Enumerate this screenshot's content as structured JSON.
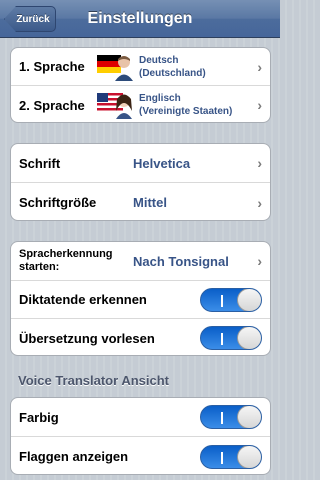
{
  "nav": {
    "back_label": "Zurück",
    "title": "Einstellungen"
  },
  "languages": [
    {
      "label": "1. Sprache",
      "name_line1": "Deutsch",
      "name_line2": "(Deutschland)",
      "flag": "germany-flag-icon"
    },
    {
      "label": "2. Sprache",
      "name_line1": "Englisch",
      "name_line2": "(Vereinigte Staaten)",
      "flag": "usa-flag-icon"
    }
  ],
  "font": {
    "font_label": "Schrift",
    "font_value": "Helvetica",
    "size_label": "Schriftgröße",
    "size_value": "Mittel"
  },
  "recognition": {
    "start_label_line1": "Spracherkennung",
    "start_label_line2": "starten:",
    "start_value": "Nach Tonsignal",
    "end_label": "Diktatende erkennen",
    "read_label": "Übersetzung vorlesen"
  },
  "view_section": {
    "header": "Voice Translator Ansicht",
    "color_label": "Farbig",
    "flags_label": "Flaggen anzeigen"
  },
  "toggle_colors": {
    "on": "#2f7fe0"
  }
}
